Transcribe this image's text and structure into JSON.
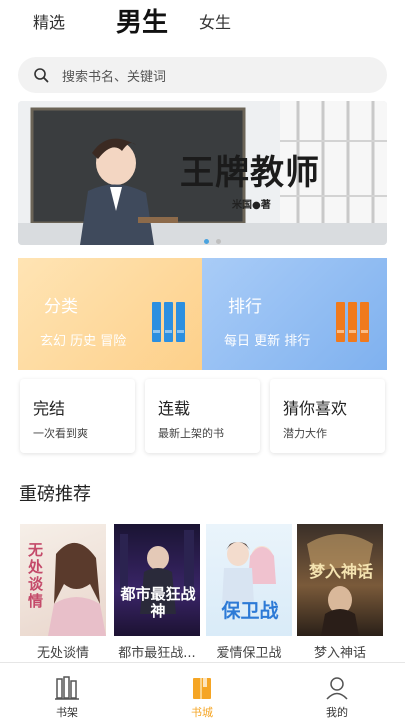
{
  "top_tabs": {
    "featured": "精选",
    "male": "男生",
    "female": "女生"
  },
  "search": {
    "placeholder": "搜索书名、关键词"
  },
  "banner": {
    "title": "王牌教师",
    "author": "米国●著",
    "page_count": 2,
    "active_index": 0
  },
  "categories": [
    {
      "title": "分类",
      "subtitle": "玄幻 历史 冒险",
      "color": "#fdd08a"
    },
    {
      "title": "排行",
      "subtitle": "每日 更新 排行",
      "color": "#7fb1ef"
    }
  ],
  "shortcuts": [
    {
      "title": "完结",
      "subtitle": "一次看到爽"
    },
    {
      "title": "连载",
      "subtitle": "最新上架的书"
    },
    {
      "title": "猜你喜欢",
      "subtitle": "潜力大作"
    }
  ],
  "section": {
    "title": "重磅推荐"
  },
  "books": [
    {
      "title": "无处谈情",
      "cover_text": "无处谈情"
    },
    {
      "title": "都市最狂战...",
      "cover_text": "都市最狂战神"
    },
    {
      "title": "爱情保卫战",
      "cover_text": "保卫战"
    },
    {
      "title": "梦入神话",
      "cover_text": "梦入神话"
    }
  ],
  "bottom_nav": [
    {
      "label": "书架",
      "icon": "bookshelf-icon"
    },
    {
      "label": "书城",
      "icon": "bookstore-icon",
      "active": true
    },
    {
      "label": "我的",
      "icon": "user-icon"
    }
  ],
  "colors": {
    "accent": "#f5a524",
    "dot_active": "#4aa3df"
  }
}
